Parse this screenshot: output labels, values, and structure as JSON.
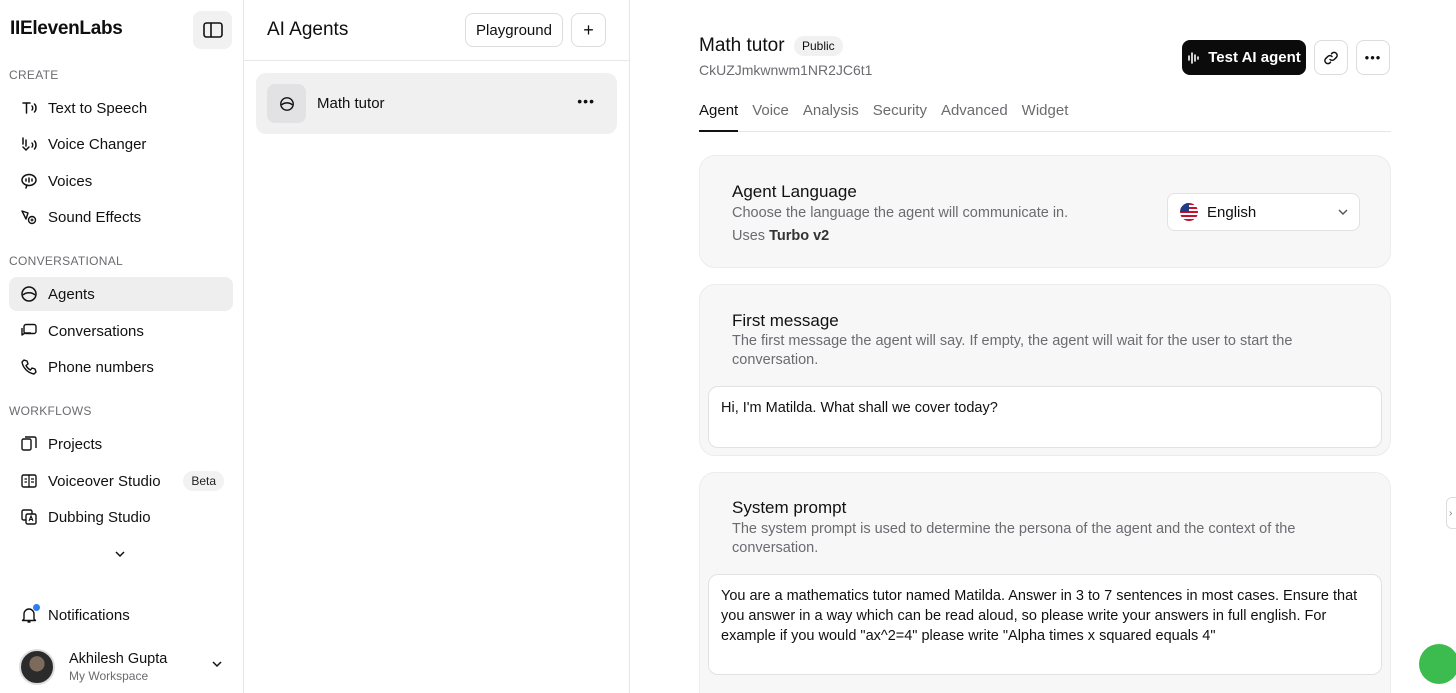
{
  "brand": "IIElevenLabs",
  "sidebar": {
    "sections": [
      {
        "label": "CREATE"
      },
      {
        "label": "CONVERSATIONAL"
      },
      {
        "label": "WORKFLOWS"
      }
    ],
    "items": [
      {
        "label": "Text to Speech",
        "icon": "text-to-speech-icon"
      },
      {
        "label": "Voice Changer",
        "icon": "voice-changer-icon"
      },
      {
        "label": "Voices",
        "icon": "voices-icon"
      },
      {
        "label": "Sound Effects",
        "icon": "sound-effects-icon"
      },
      {
        "label": "Agents",
        "icon": "agents-icon",
        "active": true
      },
      {
        "label": "Conversations",
        "icon": "conversations-icon"
      },
      {
        "label": "Phone numbers",
        "icon": "phone-icon"
      },
      {
        "label": "Projects",
        "icon": "projects-icon"
      },
      {
        "label": "Voiceover Studio",
        "icon": "voiceover-studio-icon",
        "badge": "Beta"
      },
      {
        "label": "Dubbing Studio",
        "icon": "dubbing-studio-icon"
      }
    ],
    "notifications": "Notifications",
    "user": {
      "name": "Akhilesh Gupta",
      "workspace": "My Workspace"
    }
  },
  "list": {
    "title": "AI Agents",
    "playground": "Playground",
    "add": "+",
    "agents": [
      {
        "name": "Math tutor"
      }
    ]
  },
  "main": {
    "title": "Math tutor",
    "badge": "Public",
    "agent_id": "CkUZJmkwnwm1NR2JC6t1",
    "test_button": "Test AI agent",
    "tabs": [
      "Agent",
      "Voice",
      "Analysis",
      "Security",
      "Advanced",
      "Widget"
    ],
    "active_tab": "Agent",
    "language": {
      "title": "Agent Language",
      "desc": "Choose the language the agent will communicate in.",
      "uses_prefix": "Uses ",
      "uses_model": "Turbo v2",
      "selected": "English"
    },
    "first_message": {
      "title": "First message",
      "desc": "The first message the agent will say. If empty, the agent will wait for the user to start the conversation.",
      "value": "Hi, I'm Matilda. What shall we cover today?"
    },
    "system_prompt": {
      "title": "System prompt",
      "desc": "The system prompt is used to determine the persona of the agent and the context of the conversation.",
      "value": "You are a mathematics tutor named Matilda. Answer in 3 to 7 sentences in most cases. Ensure that you answer in a way which can be read aloud, so please write your answers in full english. For example if you would \"ax^2=4\" please write \"Alpha times x squared equals 4\""
    }
  }
}
